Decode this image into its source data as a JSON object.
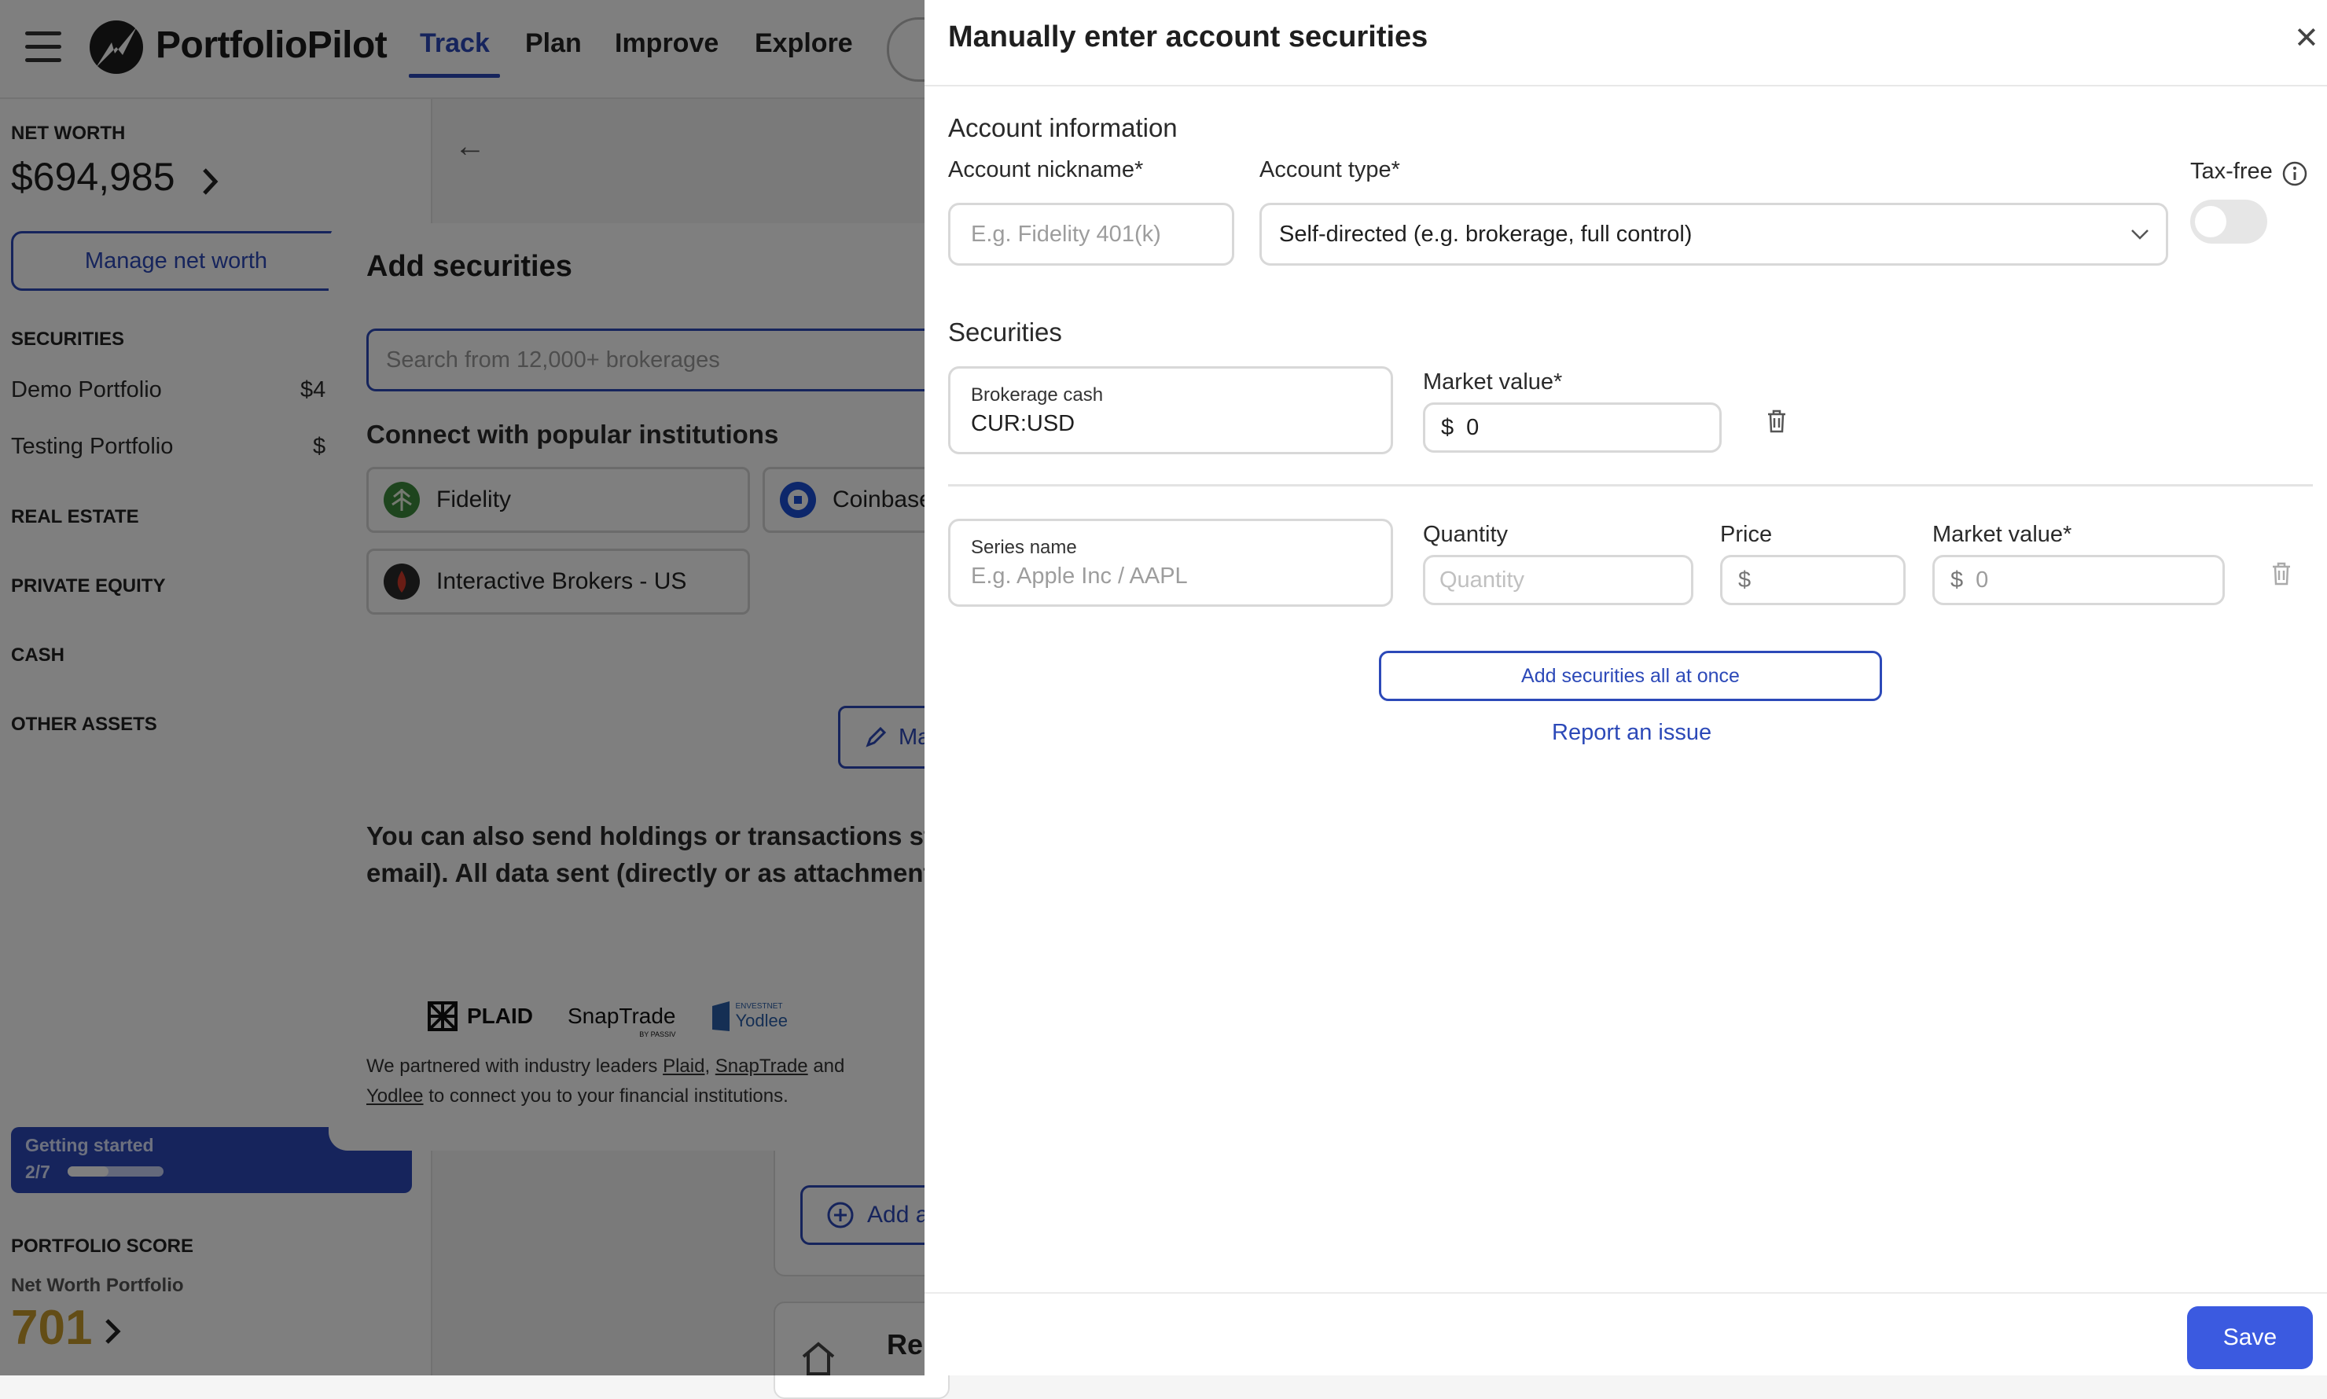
{
  "header": {
    "brand": "PortfolioPilot",
    "nav": [
      "Track",
      "Plan",
      "Improve",
      "Explore"
    ]
  },
  "sidebar": {
    "net_worth_label": "NET WORTH",
    "net_worth_value": "$694,985",
    "manage_button": "Manage net worth",
    "securities_label": "SECURITIES",
    "securities_items": [
      {
        "name": "Demo Portfolio",
        "value": "$4"
      },
      {
        "name": "Testing Portfolio",
        "value": "$"
      }
    ],
    "sections": [
      "REAL ESTATE",
      "PRIVATE EQUITY",
      "CASH",
      "OTHER ASSETS"
    ],
    "getting_started": {
      "title": "Getting started",
      "count": "2/7",
      "progress": 0.43
    },
    "portfolio_score_label": "PORTFOLIO SCORE",
    "portfolio_score_sub": "Net Worth Portfolio",
    "portfolio_score_value": "701"
  },
  "background": {
    "add_button_partial": "Add a",
    "card_title_partial": "Re"
  },
  "add_securities": {
    "title": "Add securities",
    "search_placeholder": "Search from 12,000+ brokerages",
    "connect_heading": "Connect with popular institutions",
    "institutions": [
      "Fidelity",
      "Coinbase",
      "Interactive Brokers - US"
    ],
    "manual_button_partial": "Ma",
    "info_line1": "You can also send holdings or transactions stat",
    "info_line2": "email). All data sent (directly or as attachment)",
    "partners": [
      "PLAID",
      "SnapTrade",
      "BY PASSIV",
      "ENVESTNET",
      "Yodlee"
    ],
    "partner_text_pre": "We partnered with industry leaders ",
    "partner_plaid": "Plaid",
    "partner_comma": ", ",
    "partner_snaptrade": "SnapTrade",
    "partner_and": " and",
    "partner_yodlee": "Yodlee",
    "partner_text_post": " to connect you to your financial institutions."
  },
  "panel": {
    "title": "Manually enter account securities",
    "account_info_heading": "Account information",
    "nickname_label": "Account nickname",
    "nickname_placeholder": "E.g. Fidelity 401(k)",
    "account_type_label": "Account type",
    "account_type_value": "Self-directed (e.g. brokerage, full control)",
    "tax_free_label": "Tax-free",
    "tax_free_on": false,
    "required_mark": "*",
    "securities_heading": "Securities",
    "row1": {
      "name_label": "Brokerage cash",
      "name_value": "CUR:USD",
      "market_value_label": "Market value",
      "currency": "$",
      "market_value": "0"
    },
    "row2": {
      "name_label": "Series name",
      "name_placeholder": "E.g. Apple Inc / AAPL",
      "quantity_label": "Quantity",
      "quantity_placeholder": "Quantity",
      "price_label": "Price",
      "currency": "$",
      "market_value_label": "Market value",
      "market_value_placeholder": "0"
    },
    "bulk_button": "Add securities all at once",
    "report_link": "Report an issue",
    "save_button": "Save"
  },
  "colors": {
    "accent": "#2c49b8",
    "save": "#3b5ae0",
    "score": "#c79a2d"
  }
}
